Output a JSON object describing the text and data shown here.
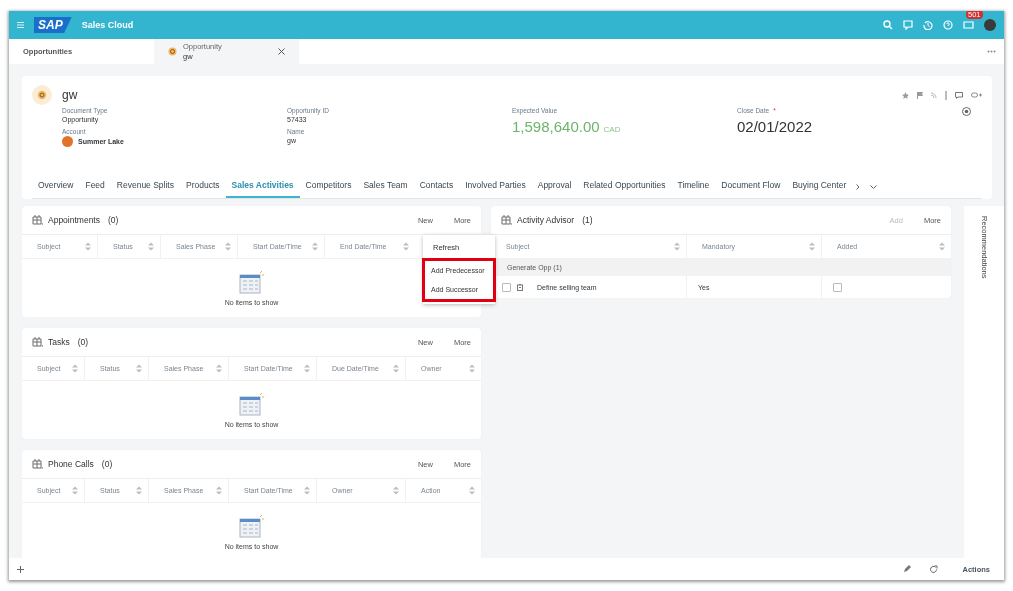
{
  "shell": {
    "logo": "SAP",
    "product": "Sales Cloud",
    "notification_count": "501"
  },
  "tabs": [
    {
      "label": "Opportunities",
      "selected": false
    },
    {
      "type_label": "Opportunity",
      "label": "gw",
      "selected": true
    }
  ],
  "header": {
    "title": "gw",
    "columns": [
      [
        {
          "kind": "text",
          "label": "Document Type",
          "value": "Opportunity"
        },
        {
          "kind": "account",
          "label": "Account",
          "value": "Summer Lake"
        }
      ],
      [
        {
          "kind": "text",
          "label": "Opportunity ID",
          "value": "57433"
        },
        {
          "kind": "text",
          "label": "Name",
          "value": "gw"
        }
      ],
      [
        {
          "kind": "amount",
          "label": "Expected Value",
          "value": "1,598,640.00",
          "currency": "CAD"
        }
      ],
      [
        {
          "kind": "date",
          "label": "Close Date",
          "value": "02/01/2022",
          "required_mark": "*"
        }
      ]
    ]
  },
  "nav": [
    {
      "label": "Overview",
      "selected": false
    },
    {
      "label": "Feed",
      "selected": false
    },
    {
      "label": "Revenue Splits",
      "selected": false
    },
    {
      "label": "Products",
      "selected": false
    },
    {
      "label": "Sales Activities",
      "selected": true
    },
    {
      "label": "Competitors",
      "selected": false
    },
    {
      "label": "Sales Team",
      "selected": false
    },
    {
      "label": "Contacts",
      "selected": false
    },
    {
      "label": "Involved Parties",
      "selected": false
    },
    {
      "label": "Approval",
      "selected": false
    },
    {
      "label": "Related Opportunities",
      "selected": false
    },
    {
      "label": "Timeline",
      "selected": false
    },
    {
      "label": "Document Flow",
      "selected": false
    },
    {
      "label": "Buying Center",
      "selected": false
    }
  ],
  "panels": [
    {
      "title": "Appointments",
      "count": "(0)",
      "actions": [
        {
          "label": "New",
          "disabled": false
        },
        {
          "label": "More",
          "disabled": false
        }
      ],
      "columns": [
        "Subject",
        "Status",
        "Sales Phase",
        "Start Date/Time",
        "End Date/Time"
      ],
      "empty_text": "No items to show"
    },
    {
      "title": "Tasks",
      "count": "(0)",
      "actions": [
        {
          "label": "New",
          "disabled": false
        },
        {
          "label": "More",
          "disabled": false
        }
      ],
      "columns": [
        "Subject",
        "Status",
        "Sales Phase",
        "Start Date/Time",
        "Due Date/Time",
        "Owner"
      ],
      "empty_text": "No items to show"
    },
    {
      "title": "Phone Calls",
      "count": "(0)",
      "actions": [
        {
          "label": "New",
          "disabled": false
        },
        {
          "label": "More",
          "disabled": false
        }
      ],
      "columns": [
        "Subject",
        "Status",
        "Sales Phase",
        "Start Date/Time",
        "Owner",
        "Action"
      ],
      "empty_text": "No items to show"
    }
  ],
  "menu": {
    "items": [
      {
        "label": "Refresh",
        "highlighted": false
      },
      {
        "label": "Add Predecessor",
        "highlighted": true
      },
      {
        "label": "Add Successor",
        "highlighted": true
      }
    ]
  },
  "advisor": {
    "title": "Activity Advisor",
    "count": "(1)",
    "actions": [
      {
        "label": "Add",
        "disabled": true
      },
      {
        "label": "More",
        "disabled": false
      }
    ],
    "columns": [
      "Subject",
      "Mandatory",
      "Added"
    ],
    "groups": [
      {
        "label": "Generate Opp (1)",
        "rows": [
          {
            "subject": "Define selling team",
            "mandatory": "Yes",
            "selected": false,
            "added": false
          }
        ]
      }
    ]
  },
  "side_panel": {
    "label": "Recommendations"
  },
  "footer": {
    "actions_label": "Actions"
  }
}
